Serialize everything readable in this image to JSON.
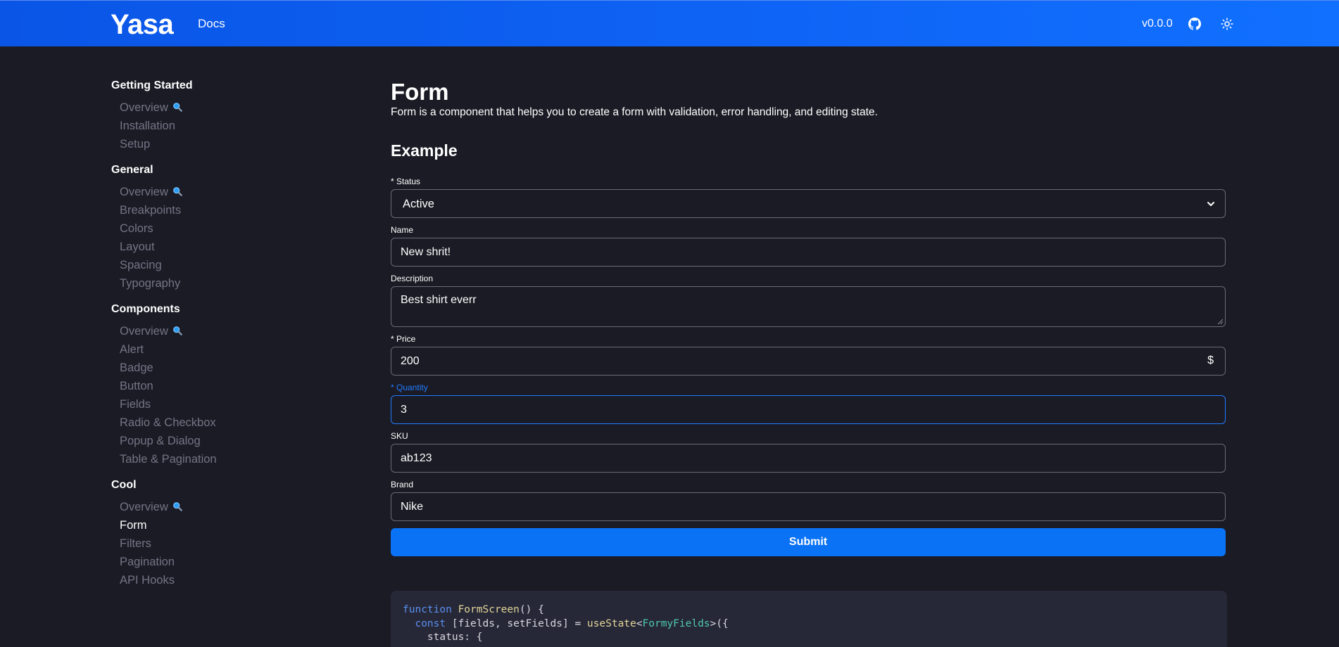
{
  "header": {
    "logo": "Yasa",
    "nav_docs": "Docs",
    "version": "v0.0.0",
    "github_icon": "github-icon",
    "theme_icon": "sun-icon"
  },
  "sidebar": {
    "sections": [
      {
        "title": "Getting Started",
        "items": [
          "Overview",
          "Installation",
          "Setup"
        ]
      },
      {
        "title": "General",
        "items": [
          "Overview",
          "Breakpoints",
          "Colors",
          "Layout",
          "Spacing",
          "Typography"
        ]
      },
      {
        "title": "Components",
        "items": [
          "Overview",
          "Alert",
          "Badge",
          "Button",
          "Fields",
          "Radio & Checkbox",
          "Popup & Dialog",
          "Table & Pagination"
        ]
      },
      {
        "title": "Cool",
        "items": [
          "Overview",
          "Form",
          "Filters",
          "Pagination",
          "API Hooks"
        ]
      }
    ],
    "active_item": "Form"
  },
  "main": {
    "title": "Form",
    "description": "Form is a component that helps you to create a form with validation, error handling, and editing state.",
    "example_heading": "Example"
  },
  "form": {
    "status": {
      "label": "* Status",
      "value": "Active"
    },
    "name": {
      "label": "Name",
      "value": "New shrit!"
    },
    "description": {
      "label": "Description",
      "value": "Best shirt everr"
    },
    "price": {
      "label": "* Price",
      "value": "200",
      "suffix": "$"
    },
    "quantity": {
      "label": "* Quantity",
      "value": "3"
    },
    "sku": {
      "label": "SKU",
      "value": "ab123"
    },
    "brand": {
      "label": "Brand",
      "value": "Nike"
    },
    "submit_label": "Submit"
  },
  "code": {
    "line1_kw": "function",
    "line1_fn": "FormScreen",
    "line1_rest": "() {",
    "line2_kw": "const",
    "line2_mid": "[fields, setFields] = ",
    "line2_fn": "useState",
    "line2_lt": "<",
    "line2_ty": "FormyFields",
    "line2_end": ">({",
    "line3": "status: {"
  },
  "colors": {
    "header_gradient_start": "#0a55e6",
    "header_gradient_end": "#1170ff",
    "background": "#1b1b25",
    "accent": "#0a72f5",
    "focus": "#1f7dff",
    "sidebar_muted": "#737585"
  }
}
